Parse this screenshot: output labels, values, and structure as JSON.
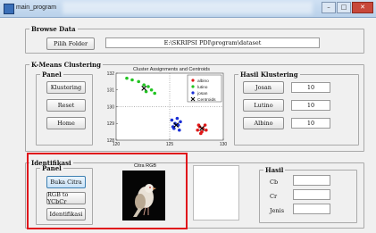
{
  "window": {
    "title": "main_program",
    "controls": [
      "–",
      "□",
      "✕"
    ]
  },
  "browse": {
    "legend": "Browse Data",
    "button": "Pilih Folder",
    "path": "E:\\SKRIPSI PDI\\program\\dataset"
  },
  "kmeans": {
    "legend": "K-Means Clustering",
    "panel_legend": "Panel",
    "buttons": [
      "Klustering",
      "Reset",
      "Home"
    ],
    "chart_title": "Cluster Assignments and Centroids",
    "hasil_legend": "Hasil Klustering",
    "results": [
      {
        "label": "Josan",
        "value": "10"
      },
      {
        "label": "Lutino",
        "value": "10"
      },
      {
        "label": "Albino",
        "value": "10"
      }
    ]
  },
  "identifikasi": {
    "legend": "Identifikasi",
    "panel_legend": "Panel",
    "buttons": [
      "Buka Citra",
      "RGB to YCbCr",
      "Identifikasi"
    ],
    "image_title": "Citra RGB",
    "hasil_legend": "Hasil",
    "fields": [
      "Cb",
      "Cr",
      "Jenis"
    ]
  },
  "chart_data": {
    "type": "scatter",
    "title": "Cluster Assignments and Centroids",
    "xlim": [
      120,
      130
    ],
    "ylim": [
      128,
      132
    ],
    "xticks": [
      120,
      125,
      130
    ],
    "yticks": [
      128,
      129,
      130,
      131,
      132
    ],
    "legend_position": "top-right",
    "series": [
      {
        "name": "albino",
        "color": "#e01818",
        "marker": "dot",
        "points": [
          [
            127.6,
            128.6
          ],
          [
            127.8,
            128.8
          ],
          [
            128.1,
            128.7
          ],
          [
            128.3,
            128.9
          ],
          [
            128.0,
            128.5
          ],
          [
            127.9,
            128.4
          ],
          [
            128.4,
            128.6
          ],
          [
            127.7,
            128.9
          ]
        ]
      },
      {
        "name": "lutino",
        "color": "#22c422",
        "marker": "dot",
        "points": [
          [
            121.0,
            131.7
          ],
          [
            121.5,
            131.6
          ],
          [
            122.1,
            131.5
          ],
          [
            122.6,
            131.3
          ],
          [
            123.0,
            131.2
          ],
          [
            123.3,
            131.0
          ],
          [
            122.8,
            130.9
          ],
          [
            123.6,
            130.8
          ]
        ]
      },
      {
        "name": "josan",
        "color": "#1a2fd6",
        "marker": "dot",
        "points": [
          [
            125.2,
            129.2
          ],
          [
            125.5,
            129.0
          ],
          [
            125.8,
            128.9
          ],
          [
            125.4,
            128.7
          ],
          [
            126.0,
            129.1
          ],
          [
            125.7,
            129.3
          ],
          [
            125.9,
            128.6
          ],
          [
            125.3,
            128.8
          ]
        ]
      },
      {
        "name": "Centroids",
        "color": "#000000",
        "marker": "x",
        "points": [
          [
            122.6,
            131.1
          ],
          [
            125.6,
            128.9
          ],
          [
            128.0,
            128.7
          ]
        ]
      }
    ]
  }
}
